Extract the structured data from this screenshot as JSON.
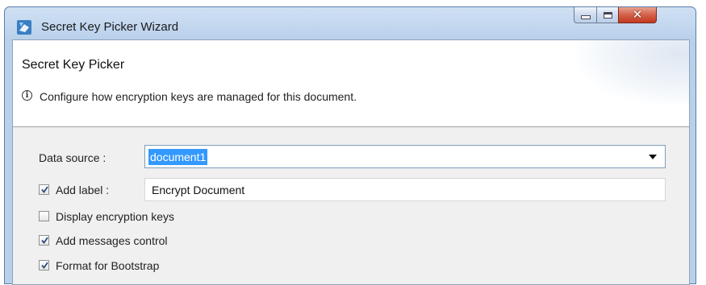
{
  "window": {
    "title": "Secret Key Picker Wizard",
    "icon": "wizard-app-icon",
    "controls": {
      "minimize": "minimize-icon",
      "maximize": "maximize-icon",
      "close": "close-icon"
    }
  },
  "banner": {
    "title": "Secret Key Picker",
    "description": "Configure how encryption keys are managed for this document.",
    "info_icon": "info-icon"
  },
  "form": {
    "data_source": {
      "label": "Data source :",
      "value": "document1"
    },
    "add_label": {
      "label": "Add label :",
      "checked": true,
      "value": "Encrypt Document"
    },
    "display_keys": {
      "label": "Display encryption keys",
      "checked": false
    },
    "messages_control": {
      "label": "Add messages control",
      "checked": true
    },
    "bootstrap": {
      "label": "Format for Bootstrap",
      "checked": true
    }
  },
  "colors": {
    "selection": "#3399ff",
    "title_bar": "#bdd3ec",
    "close_button": "#c2391f"
  }
}
